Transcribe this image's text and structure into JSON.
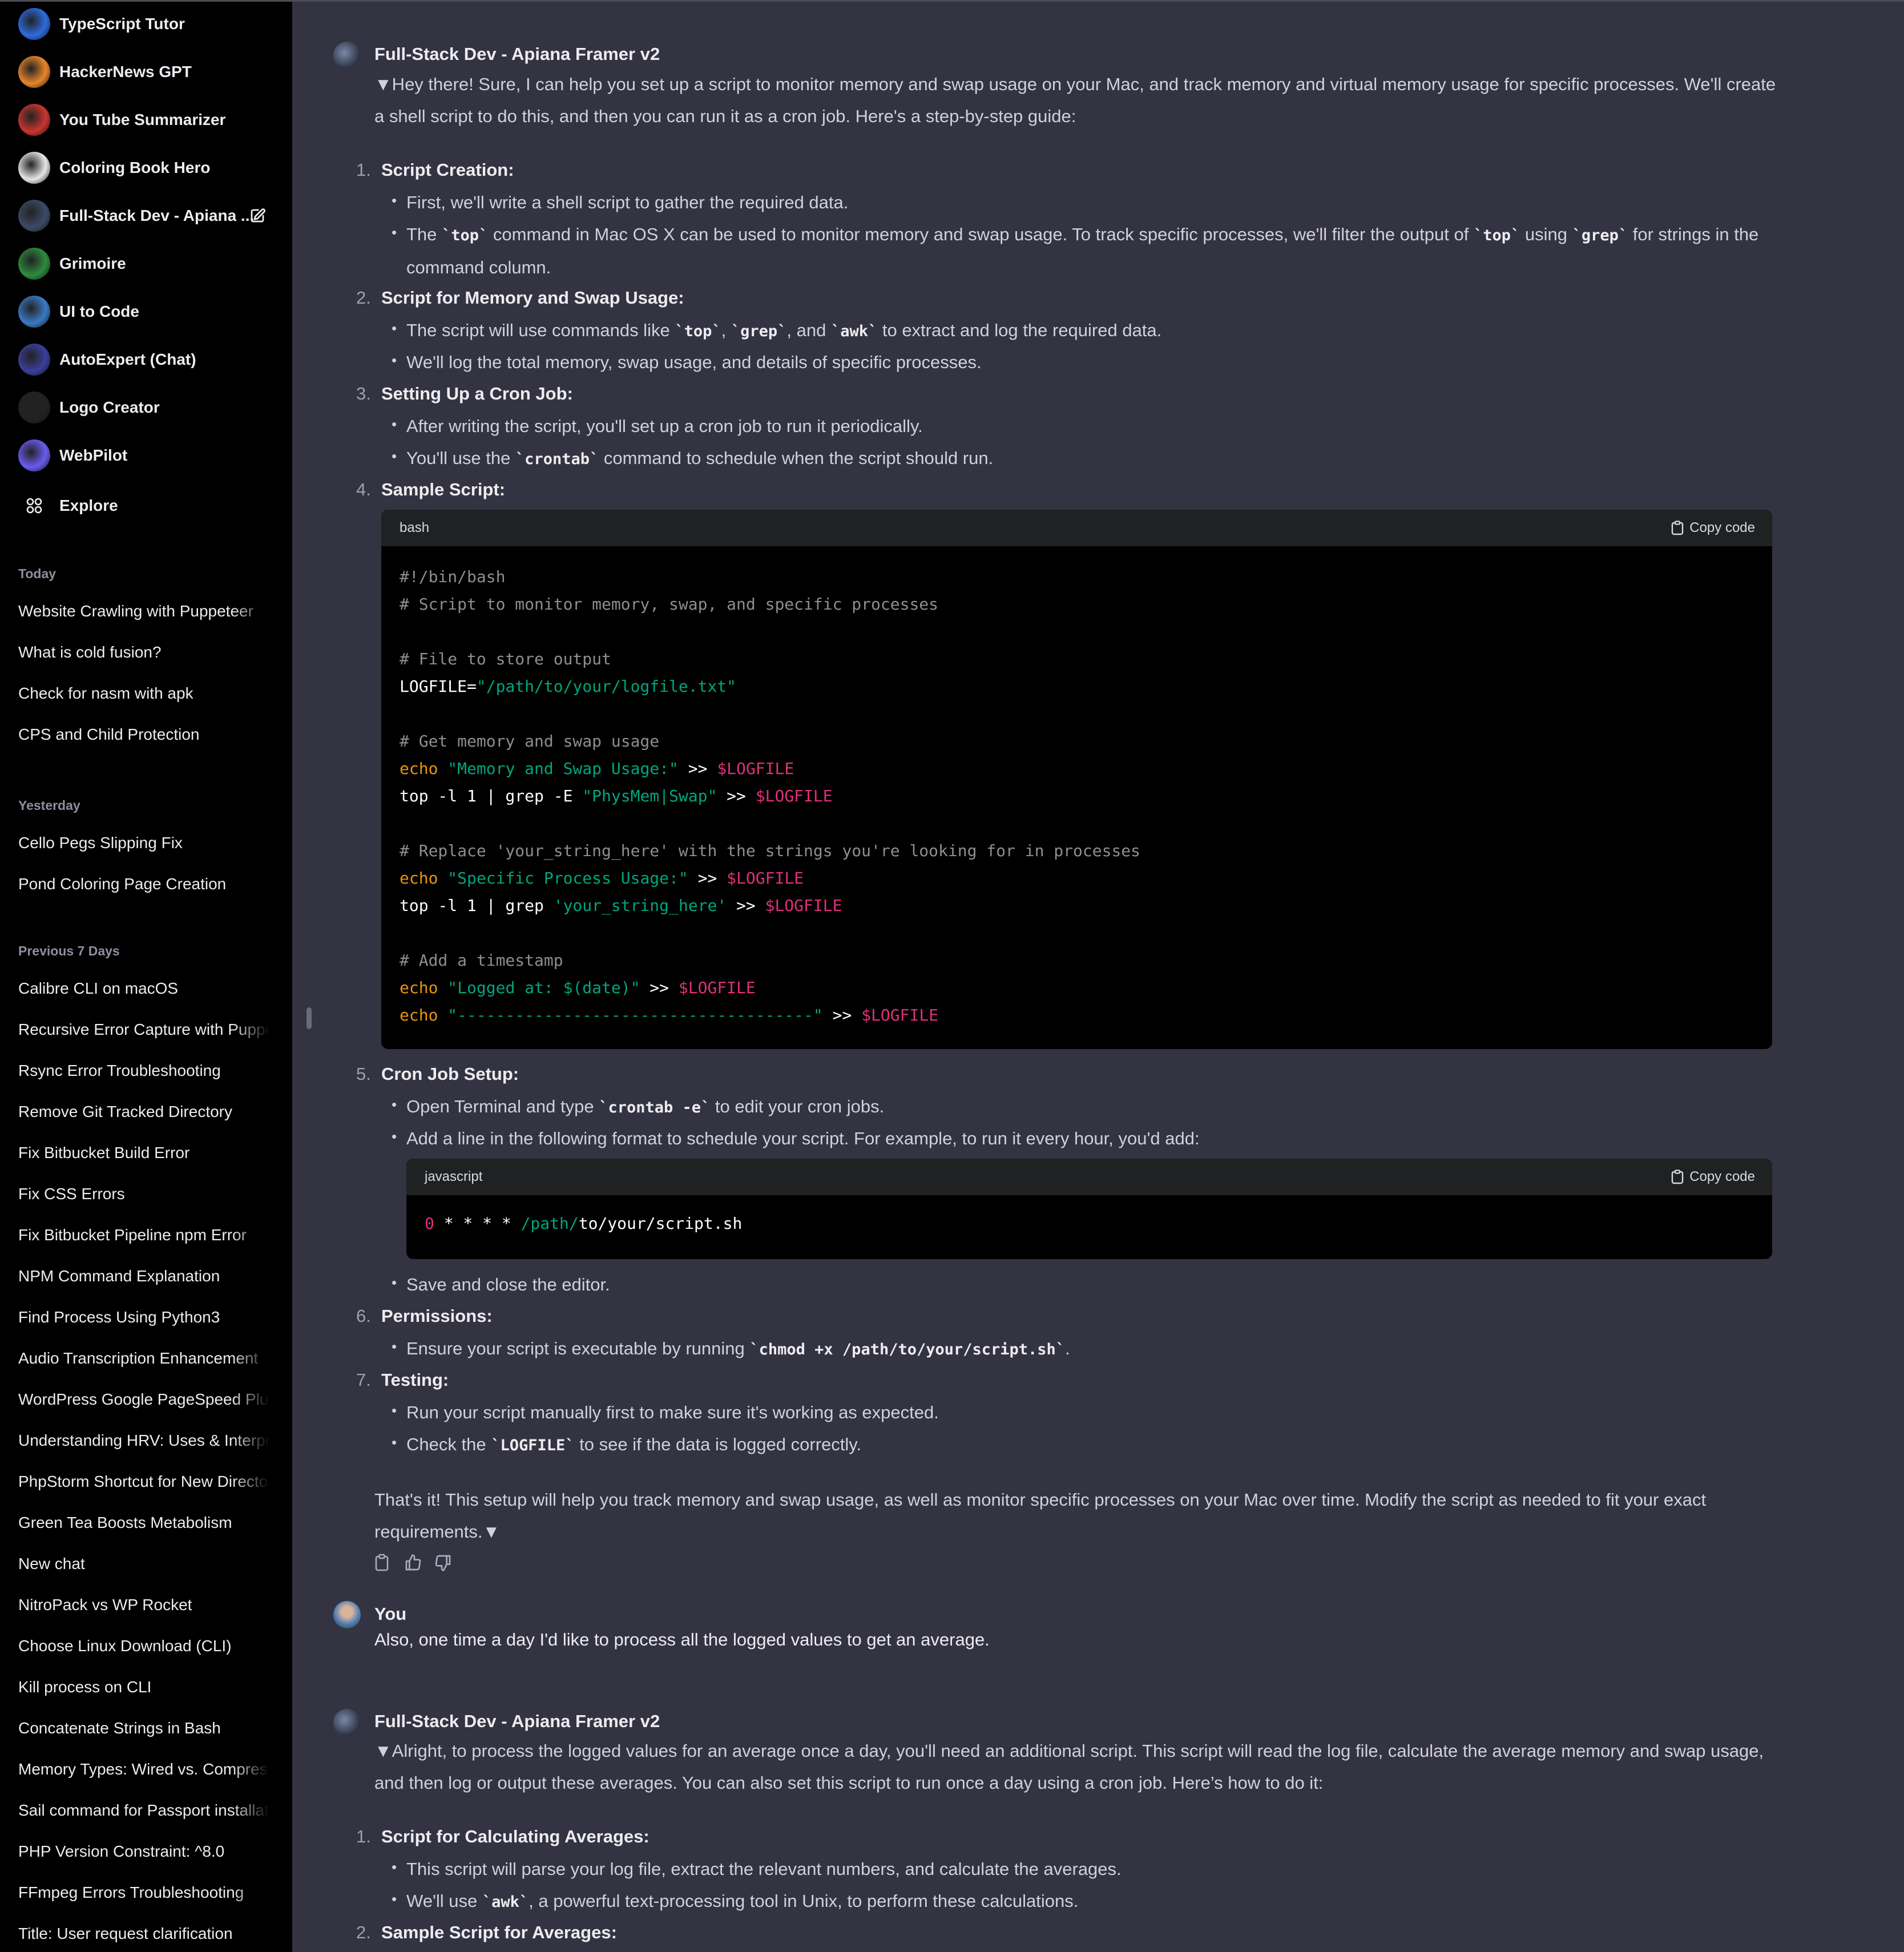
{
  "sidebar": {
    "gpts": [
      {
        "label": "TypeScript Tutor",
        "icon": "typescript-tutor-avatar",
        "color": "#2d6cdf"
      },
      {
        "label": "HackerNews GPT",
        "icon": "hackernews-gpt-avatar",
        "color": "#e8862a"
      },
      {
        "label": "You Tube Summarizer",
        "icon": "youtube-summarizer-avatar",
        "color": "#c8352e"
      },
      {
        "label": "Coloring Book Hero",
        "icon": "coloring-book-hero-avatar",
        "color": "#e6e6e6"
      },
      {
        "label": "Full-Stack Dev - Apiana ...",
        "icon": "fullstack-dev-avatar",
        "color": "#3c4a66"
      },
      {
        "label": "Grimoire",
        "icon": "grimoire-avatar",
        "color": "#2e8b3e"
      },
      {
        "label": "UI to Code",
        "icon": "ui-to-code-avatar",
        "color": "#3a7ac4"
      },
      {
        "label": "AutoExpert (Chat)",
        "icon": "autoexpert-avatar",
        "color": "#3b3f9a"
      },
      {
        "label": "Logo Creator",
        "icon": "logo-creator-avatar",
        "color": "#222222"
      },
      {
        "label": "WebPilot",
        "icon": "webpilot-avatar",
        "color": "#6a5cf0"
      }
    ],
    "explore_label": "Explore",
    "sections": [
      {
        "title": "Today",
        "items": [
          "Website Crawling with Puppeteer",
          "What is cold fusion?",
          "Check for nasm with apk",
          "CPS and Child Protection"
        ]
      },
      {
        "title": "Yesterday",
        "items": [
          "Cello Pegs Slipping Fix",
          "Pond Coloring Page Creation"
        ]
      },
      {
        "title": "Previous 7 Days",
        "items": [
          "Calibre CLI on macOS",
          "Recursive Error Capture with Puppeteer",
          "Rsync Error Troubleshooting",
          "Remove Git Tracked Directory",
          "Fix Bitbucket Build Error",
          "Fix CSS Errors",
          "Fix Bitbucket Pipeline npm Error",
          "NPM Command Explanation",
          "Find Process Using Python3",
          "Audio Transcription Enhancement",
          "WordPress Google PageSpeed Plugin",
          "Understanding HRV: Uses & Interpretation",
          "PhpStorm Shortcut for New Directory",
          "Green Tea Boosts Metabolism",
          "New chat",
          "NitroPack vs WP Rocket",
          "Choose Linux Download (CLI)",
          "Kill process on CLI",
          "Concatenate Strings in Bash",
          "Memory Types: Wired vs. Compressed",
          "Sail command for Passport installation",
          "PHP Version Constraint: ^8.0",
          "FFmpeg Errors Troubleshooting",
          "Title: User request clarification"
        ]
      }
    ]
  },
  "messages": {
    "m1": {
      "author": "Full-Stack Dev - Apiana Framer v2",
      "intro": "▼Hey there! Sure, I can help you set up a script to monitor memory and swap usage on your Mac, and track memory and virtual memory usage for specific processes. We'll create a shell script to do this, and then you can run it as a cron job. Here's a step-by-step guide:",
      "steps": [
        {
          "num": "1.",
          "title": "Script Creation:"
        },
        {
          "num": "2.",
          "title": "Script for Memory and Swap Usage:"
        },
        {
          "num": "3.",
          "title": "Setting Up a Cron Job:"
        },
        {
          "num": "4.",
          "title": "Sample Script:"
        },
        {
          "num": "5.",
          "title": "Cron Job Setup:"
        },
        {
          "num": "6.",
          "title": "Permissions:"
        },
        {
          "num": "7.",
          "title": "Testing:"
        }
      ],
      "b1a": "First, we'll write a shell script to gather the required data.",
      "b1b_pre": "The ",
      "b1b_c1": "`top`",
      "b1b_mid": " command in Mac OS X can be used to monitor memory and swap usage. To track specific processes, we'll filter the output of ",
      "b1b_c2": "`top`",
      "b1b_mid2": " using ",
      "b1b_c3": "`grep`",
      "b1b_post": " for strings in the command column.",
      "b2a_pre": "The script will use commands like ",
      "b2a_c1": "`top`",
      "b2a_s1": ", ",
      "b2a_c2": "`grep`",
      "b2a_s2": ", and ",
      "b2a_c3": "`awk`",
      "b2a_post": " to extract and log the required data.",
      "b2b": "We'll log the total memory, swap usage, and details of specific processes.",
      "b3a": "After writing the script, you'll set up a cron job to run it periodically.",
      "b3b_pre": "You'll use the ",
      "b3b_c": "`crontab`",
      "b3b_post": " command to schedule when the script should run.",
      "code1": {
        "lang": "bash",
        "copy": "Copy code",
        "l1": "#!/bin/bash",
        "l2": "# Script to monitor memory, swap, and specific processes",
        "l3": "# File to store output",
        "l4a": "LOGFILE=",
        "l4b": "\"/path/to/your/logfile.txt\"",
        "l5": "# Get memory and swap usage",
        "l6a": "echo",
        "l6b": "\"Memory and Swap Usage:\"",
        "l6c": " >> ",
        "l6d": "$LOGFILE",
        "l7a": "top -l 1 | grep -E ",
        "l7b": "\"PhysMem|Swap\"",
        "l7c": " >> ",
        "l7d": "$LOGFILE",
        "l8": "# Replace 'your_string_here' with the strings you're looking for in processes",
        "l9a": "echo",
        "l9b": "\"Specific Process Usage:\"",
        "l9c": " >> ",
        "l9d": "$LOGFILE",
        "l10a": "top -l 1 | grep ",
        "l10b": "'your_string_here'",
        "l10c": " >> ",
        "l10d": "$LOGFILE",
        "l11": "# Add a timestamp",
        "l12a": "echo",
        "l12b": "\"Logged at: $(date)\"",
        "l12c": " >> ",
        "l12d": "$LOGFILE",
        "l13a": "echo",
        "l13b": "\"-------------------------------------\"",
        "l13c": " >> ",
        "l13d": "$LOGFILE"
      },
      "b5a_pre": "Open Terminal and type ",
      "b5a_c": "`crontab -e`",
      "b5a_post": " to edit your cron jobs.",
      "b5b": "Add a line in the following format to schedule your script. For example, to run it every hour, you'd add:",
      "code2": {
        "lang": "javascript",
        "copy": "Copy code",
        "a": "0",
        "b": " * * * * ",
        "c": "/path/",
        "d": "to/your/script.sh"
      },
      "b5c": "Save and close the editor.",
      "b6_pre": "Ensure your script is executable by running ",
      "b6_c": "`chmod +x /path/to/your/script.sh`",
      "b6_post": ".",
      "b7a": "Run your script manually first to make sure it's working as expected.",
      "b7b_pre": "Check the ",
      "b7b_c": "`LOGFILE`",
      "b7b_post": " to see if the data is logged correctly.",
      "outro": "That's it! This setup will help you track memory and swap usage, as well as monitor specific processes on your Mac over time. Modify the script as needed to fit your exact requirements.▼"
    },
    "m2": {
      "author": "You",
      "text": "Also, one time a day I'd like to process all the logged values to get an average."
    },
    "m3": {
      "author": "Full-Stack Dev - Apiana Framer v2",
      "intro": "▼Alright, to process the logged values for an average once a day, you'll need an additional script. This script will read the log file, calculate the average memory and swap usage, and then log or output these averages. You can also set this script to run once a day using a cron job. Here’s how to do it:",
      "s1_num": "1.",
      "s1_title": "Script for Calculating Averages:",
      "s1a": "This script will parse your log file, extract the relevant numbers, and calculate the averages.",
      "s1b_pre": "We'll use ",
      "s1b_c": "`awk`",
      "s1b_post": ", a powerful text-processing tool in Unix, to perform these calculations.",
      "s2_num": "2.",
      "s2_title": "Sample Script for Averages:"
    }
  }
}
